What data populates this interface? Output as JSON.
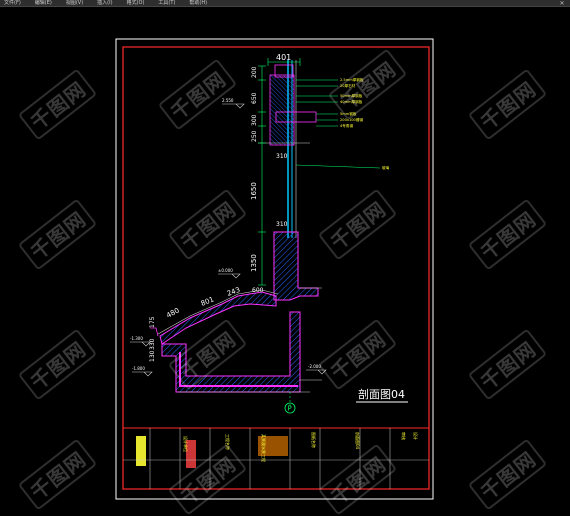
{
  "menubar": {
    "items": [
      "文件(F)",
      "编辑(E)",
      "视图(V)",
      "插入(I)",
      "格式(O)",
      "工具(T)",
      "帮助(H)"
    ],
    "close_glyph": "✕"
  },
  "drawing": {
    "section_title": "剖面图04",
    "axis_label": "P",
    "dimensions": {
      "top_width": "401",
      "d200": "200",
      "d650": "650",
      "d300": "300",
      "d250": "250",
      "d310_upper": "310",
      "d1650": "1650",
      "d310_lower": "310",
      "d1350": "1350",
      "d600": "600",
      "d243": "243",
      "d801": "801",
      "d480": "480",
      "d175": "175",
      "d330": "330",
      "d130": "130"
    },
    "levels": {
      "upper": "2.550",
      "mid": "±0.000",
      "left": "-1.300",
      "left_low": "-1.800",
      "right_low": "-2.000"
    },
    "notes": [
      "2.5mm厚钢板",
      "20厚石材",
      "50mm厚钢板",
      "40mm厚钢板",
      "5mm钢板",
      "200x100槽钢",
      "4号角钢"
    ],
    "callout": "玻璃"
  },
  "title_block": {
    "cells": [
      "设计单位",
      "工程名称",
      "图纸名称",
      "剖面图",
      "图号",
      "比例",
      "日期",
      "审核",
      "设计",
      "制图"
    ],
    "highlight": "某景观水景工程",
    "sheet_label": "图纸名称",
    "sheet_value": "剖面图04"
  },
  "watermark_text": "千图网",
  "colors": {
    "background": "#000000",
    "frame": "#ff2a2a",
    "sheet_border": "#ffffff",
    "structure": "#ff33ff",
    "concrete": "#2266ff",
    "glass": "#00c8ff",
    "dimension": "#00ff66",
    "text": "#ffff33",
    "wall": "#cfcfcf"
  }
}
